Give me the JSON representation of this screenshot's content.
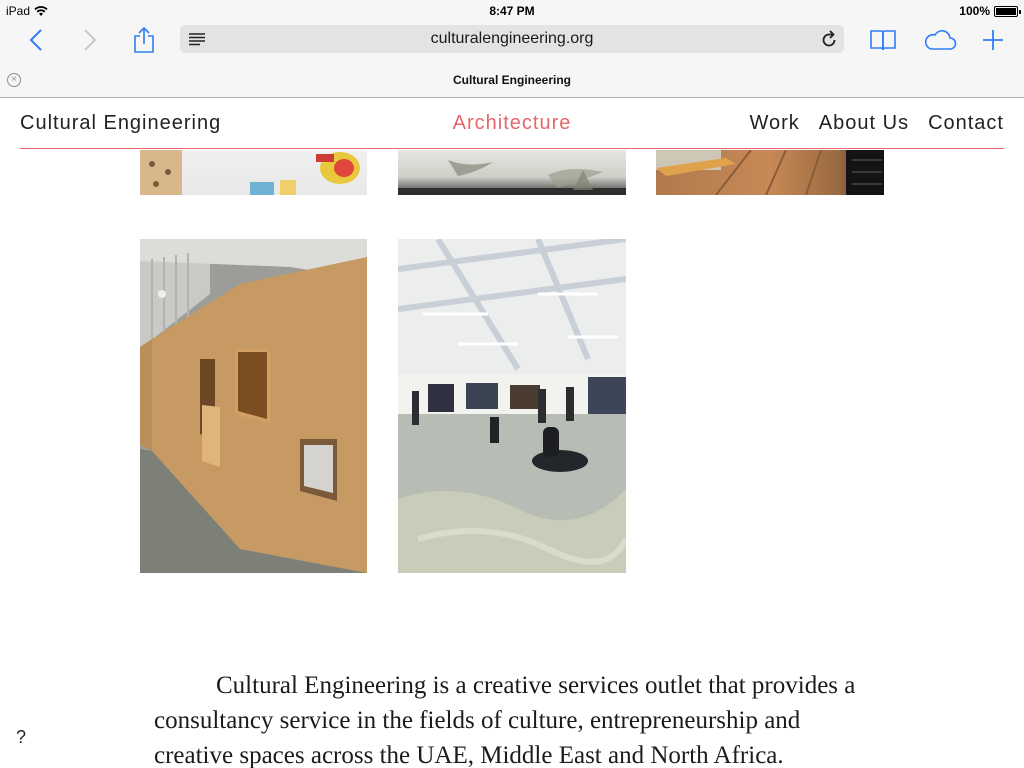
{
  "status_bar": {
    "device": "iPad",
    "time": "8:47 PM",
    "battery": "100%",
    "battery_level": 1.0
  },
  "browser": {
    "url": "culturalengineering.org",
    "tab_title": "Cultural Engineering",
    "icons": {
      "back": "chevron-left-icon",
      "forward": "chevron-right-icon",
      "share": "share-icon",
      "reader": "reader-icon",
      "reload": "reload-icon",
      "bookmarks": "book-icon",
      "cloud_tabs": "cloud-icon",
      "new_tab": "plus-icon",
      "close_tab": "close-icon"
    },
    "accent_color": "#2f7df6"
  },
  "site": {
    "brand": "Cultural Engineering",
    "current_section": "Architecture",
    "menu": [
      "Work",
      "About Us",
      "Contact"
    ],
    "accent_color": "#e5676a"
  },
  "gallery": {
    "rows": 2,
    "tiles": 5
  },
  "intro_text": "Cultural Engineering is a creative services outlet that provides a consultancy service in the fields of culture, entrepreneurship and creative spaces across the UAE, Middle East and North Africa.",
  "help_label": "?"
}
